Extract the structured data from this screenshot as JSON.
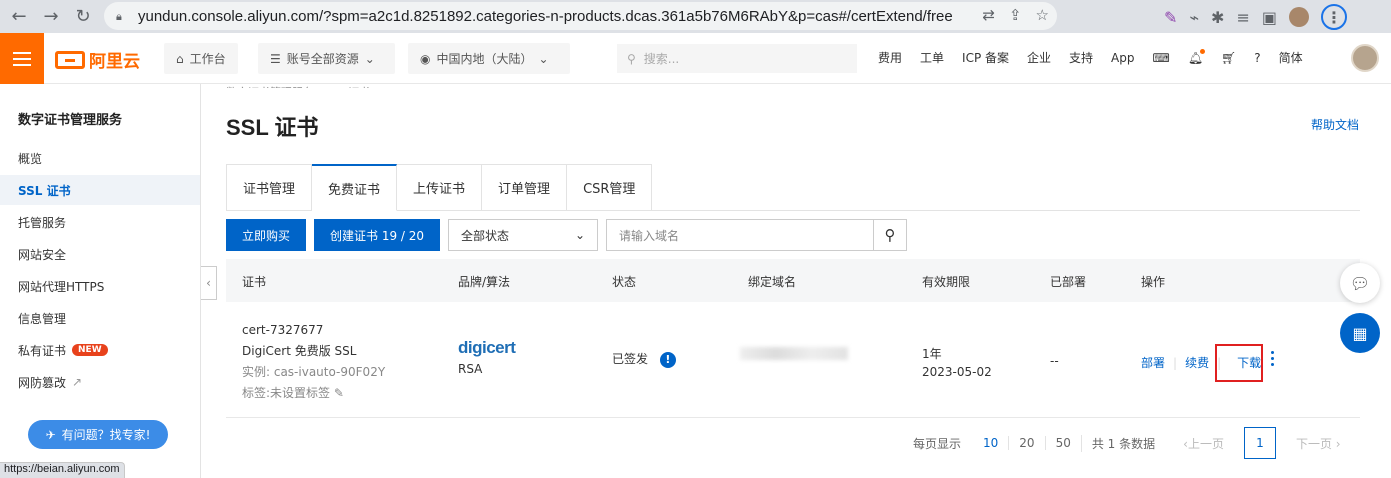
{
  "browser": {
    "url": "yundun.console.aliyun.com/?spm=a2c1d.8251892.categories-n-products.dcas.361a5b76M6RAbY&p=cas#/certExtend/free",
    "status_url": "https://beian.aliyun.com"
  },
  "topnav": {
    "logo_text": "阿里云",
    "workbench": "工作台",
    "resources": "账号全部资源",
    "region": "中国内地（大陆）",
    "search_placeholder": "搜索...",
    "links": [
      "费用",
      "工单",
      "ICP 备案",
      "企业",
      "支持",
      "App"
    ],
    "language": "简体"
  },
  "sidebar": {
    "title": "数字证书管理服务",
    "items": [
      {
        "label": "概览"
      },
      {
        "label": "SSL 证书"
      },
      {
        "label": "托管服务"
      },
      {
        "label": "网站安全"
      },
      {
        "label": "网站代理HTTPS"
      },
      {
        "label": "信息管理"
      },
      {
        "label": "私有证书",
        "badge": "NEW"
      },
      {
        "label": "网防篡改"
      }
    ],
    "help_button": "有问题？找专家!"
  },
  "main": {
    "breadcrumb": "数字证书管理服务 / SSL 证书",
    "title": "SSL 证书",
    "help_doc": "帮助文档",
    "tabs": [
      "证书管理",
      "免费证书",
      "上传证书",
      "订单管理",
      "CSR管理"
    ],
    "buy_button": "立即购买",
    "create_button": "创建证书 19 / 20",
    "status_select": "全部状态",
    "domain_placeholder": "请输入域名"
  },
  "table": {
    "headers": [
      "证书",
      "品牌/算法",
      "状态",
      "绑定域名",
      "有效期限",
      "已部署",
      "操作"
    ],
    "row": {
      "cert_id": "cert-7327677",
      "cert_name": "DigiCert 免费版 SSL",
      "instance": "实例: cas-ivauto-90F02Y",
      "tag": "标签:未设置标签",
      "brand": "digicert",
      "algorithm": "RSA",
      "status": "已签发",
      "validity": "1年",
      "expiry": "2023-05-02",
      "deployed": "--",
      "actions": [
        "部署",
        "续费",
        "下载"
      ]
    }
  },
  "pagination": {
    "per_page_label": "每页显示",
    "sizes": [
      "10",
      "20",
      "50"
    ],
    "total": "共 1 条数据",
    "prev": "上一页",
    "current": "1",
    "next": "下一页"
  }
}
